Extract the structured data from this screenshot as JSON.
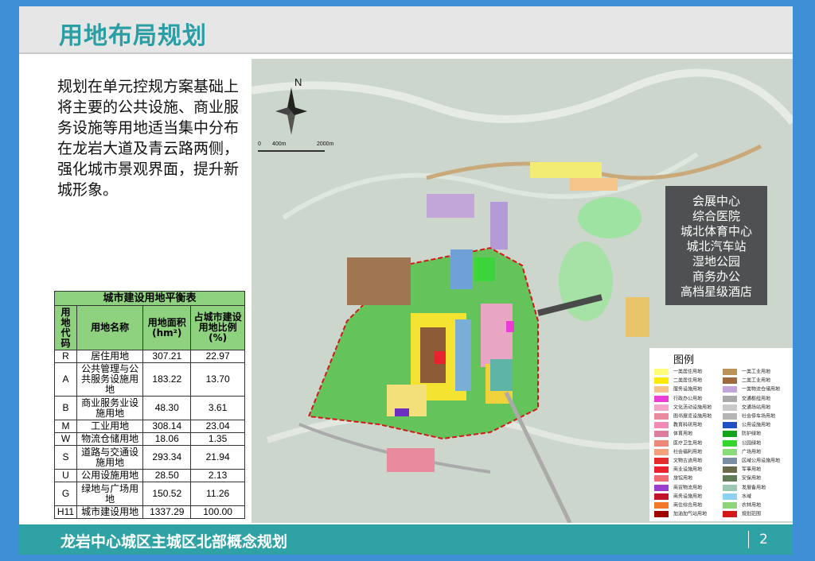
{
  "header": {
    "title": "用地布局规划"
  },
  "intro": {
    "text": "规划在单元控规方案基础上将主要的公共设施、商业服务设施等用地适当集中分布在龙岩大道及青云路两侧，强化城市景观界面，提升新城形象。"
  },
  "table": {
    "caption": "城市建设用地平衡表",
    "headers": [
      "用地代码",
      "用地名称",
      "用地面积(hm²)",
      "占城市建设用地比例(%)"
    ],
    "rows": [
      {
        "code": "R",
        "name": "居住用地",
        "area": "307.21",
        "ratio": "22.97"
      },
      {
        "code": "A",
        "name": "公共管理与公共服务设施用地",
        "area": "183.22",
        "ratio": "13.70"
      },
      {
        "code": "B",
        "name": "商业服务业设施用地",
        "area": "48.30",
        "ratio": "3.61"
      },
      {
        "code": "M",
        "name": "工业用地",
        "area": "308.14",
        "ratio": "23.04"
      },
      {
        "code": "W",
        "name": "物流仓储用地",
        "area": "18.06",
        "ratio": "1.35"
      },
      {
        "code": "S",
        "name": "道路与交通设施用地",
        "area": "293.34",
        "ratio": "21.94"
      },
      {
        "code": "U",
        "name": "公用设施用地",
        "area": "28.50",
        "ratio": "2.13"
      },
      {
        "code": "G",
        "name": "绿地与广场用地",
        "area": "150.52",
        "ratio": "11.26"
      },
      {
        "code": "H11",
        "name": "城市建设用地",
        "area": "1337.29",
        "ratio": "100.00"
      }
    ]
  },
  "map": {
    "north_label": "N",
    "scale": [
      "0",
      "400m",
      "2000m"
    ],
    "callout": [
      "会展中心",
      "综合医院",
      "城北体育中心",
      "城北汽车站",
      "湿地公园",
      "商务办公",
      "高档星级酒店"
    ],
    "legend_title": "图例",
    "legend_left": [
      {
        "label": "一类居住用地",
        "color": "#fffc7a"
      },
      {
        "label": "二类居住用地",
        "color": "#ffea00"
      },
      {
        "label": "服务设施用地",
        "color": "#f4c48a"
      },
      {
        "label": "行政办公用地",
        "color": "#ea3dd4"
      },
      {
        "label": "文化活动设施用地",
        "color": "#f3a6c9"
      },
      {
        "label": "图书展览设施用地",
        "color": "#e8899e"
      },
      {
        "label": "教育科研用地",
        "color": "#f28ab6"
      },
      {
        "label": "体育用地",
        "color": "#dc7f9f"
      },
      {
        "label": "医疗卫生用地",
        "color": "#ec8a7a"
      },
      {
        "label": "社会福利用地",
        "color": "#f4a07c"
      },
      {
        "label": "文物古迹用地",
        "color": "#e32d2d"
      },
      {
        "label": "商业设施用地",
        "color": "#e8232f"
      },
      {
        "label": "旅馆用地",
        "color": "#f06b74"
      },
      {
        "label": "商贸物流用地",
        "color": "#9b3fd0"
      },
      {
        "label": "商务设施用地",
        "color": "#c2152a"
      },
      {
        "label": "商住综合用地",
        "color": "#f2792a"
      },
      {
        "label": "加油加气站用地",
        "color": "#a10000"
      }
    ],
    "legend_right": [
      {
        "label": "一类工业用地",
        "color": "#b9935a"
      },
      {
        "label": "二类工业用地",
        "color": "#9c6a3e"
      },
      {
        "label": "一类物流仓储用地",
        "color": "#c3a6d9"
      },
      {
        "label": "交通枢纽用地",
        "color": "#a9a9a9"
      },
      {
        "label": "交通场站用地",
        "color": "#c9c9c9"
      },
      {
        "label": "社会停车场用地",
        "color": "#b5b5b5"
      },
      {
        "label": "公用设施用地",
        "color": "#1f4fc2"
      },
      {
        "label": "防护绿地",
        "color": "#15a31b"
      },
      {
        "label": "公园绿地",
        "color": "#35d62d"
      },
      {
        "label": "广场用地",
        "color": "#8adc7a"
      },
      {
        "label": "区域公用设施用地",
        "color": "#7b8fa3"
      },
      {
        "label": "军事用地",
        "color": "#6b6b4a"
      },
      {
        "label": "安保用地",
        "color": "#5f7d58"
      },
      {
        "label": "发展备用地",
        "color": "#9cc7b0"
      },
      {
        "label": "水域",
        "color": "#8fd1f2"
      },
      {
        "label": "农林用地",
        "color": "#8fd37a"
      },
      {
        "label": "规划范围",
        "color": "#d31818"
      }
    ]
  },
  "footer": {
    "text": "龙岩中心城区主城区北部概念规划",
    "page": "2"
  }
}
